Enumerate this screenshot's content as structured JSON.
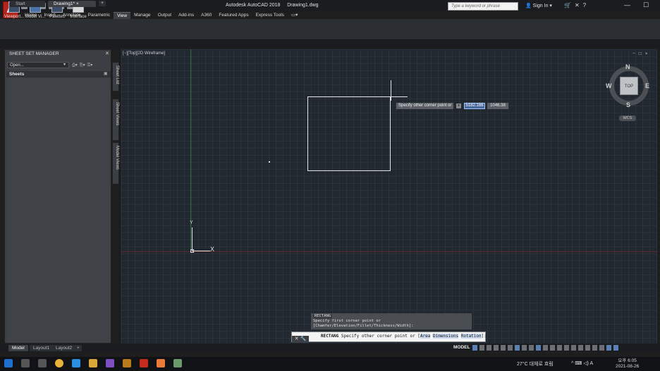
{
  "title_bar": {
    "app_title": "Autodesk AutoCAD 2018",
    "file_title": "Drawing1.dwg",
    "search_placeholder": "Type a keyword or phrase",
    "signin_label": "Sign In",
    "window_controls": [
      "—",
      "☐",
      "✕"
    ]
  },
  "ribbon": {
    "tabs": [
      "Home",
      "Insert",
      "Annotate",
      "Parametric",
      "View",
      "Manage",
      "Output",
      "Add-ins",
      "A360",
      "Featured Apps",
      "Express Tools"
    ],
    "active_tab": "View",
    "buttons": [
      {
        "label": "Viewport...",
        "icon": "viewport-config-icon"
      },
      {
        "label": "Model Vi...",
        "icon": "model-viewports-icon"
      },
      {
        "label": "Palettes",
        "icon": "palettes-icon"
      },
      {
        "label": "Interface",
        "icon": "interface-icon"
      }
    ]
  },
  "file_tabs": [
    "Start",
    "Drawing1*"
  ],
  "sheet_set_manager": {
    "title": "SHEET SET MANAGER",
    "open_dropdown": "Open...",
    "sheets_header": "Sheets",
    "side_tabs": [
      "Sheet List",
      "Sheet Views",
      "Model Views"
    ]
  },
  "viewport": {
    "label": "[−][Top][2D Wireframe]",
    "controls": [
      "−",
      "□",
      "×"
    ],
    "tooltip": "Specify other corner point or",
    "input_x": "5182.166",
    "input_y": "1046.38"
  },
  "view_cube": {
    "top": "TOP",
    "n": "N",
    "s": "S",
    "e": "E",
    "w": "W",
    "wcs": "WCS"
  },
  "ucs": {
    "y": "Y",
    "x": "X"
  },
  "command_line": {
    "history_title": "RECTANG",
    "history_text": "Specify first corner point or [Chamfer/Elevation/Fillet/Thickness/Width]:",
    "prompt_cmd": "RECTANG",
    "prompt_text": "Specify other corner point or [",
    "opt1": "Area",
    "opt2": "Dimensions",
    "opt3": "Rotation",
    "prompt_end": "]:"
  },
  "layout_tabs": [
    "Model",
    "Layout1",
    "Layout2"
  ],
  "status_bar": {
    "model": "MODEL"
  },
  "taskbar": {
    "weather": "27°C 대체로 흐림",
    "tray": "^  ⌨  ◁)  A",
    "time_ampm": "오후 6:05",
    "date": "2021-08-26"
  },
  "colors": {
    "autocad_red": "#b5241c",
    "drawing_bg": "#212830",
    "accent_blue": "#5a7fb3"
  }
}
